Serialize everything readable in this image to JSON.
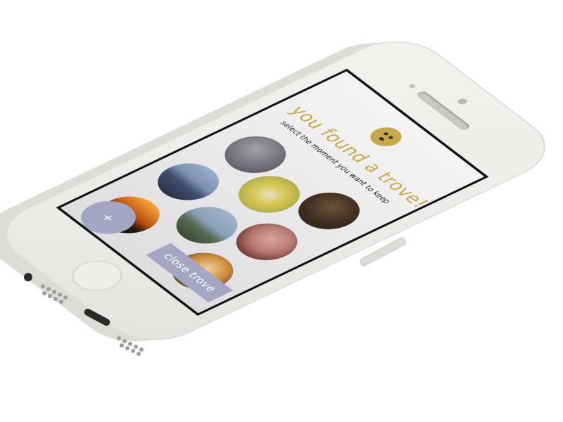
{
  "app": {
    "title": "you found a trove!",
    "subtitle": "select the moment you want to keep"
  },
  "moments": [
    {
      "name": "moment-photo-1"
    },
    {
      "name": "moment-photo-2"
    },
    {
      "name": "moment-photo-3"
    },
    {
      "name": "moment-photo-4"
    },
    {
      "name": "moment-photo-5"
    },
    {
      "name": "moment-photo-6"
    },
    {
      "name": "moment-photo-7"
    },
    {
      "name": "moment-photo-8"
    }
  ],
  "actions": {
    "close_label": "close trove",
    "add_label": "+"
  },
  "icons": {
    "trove": "trove-face-icon"
  },
  "colors": {
    "accent": "#c8a84a",
    "button": "#a4a6c4",
    "phone_body": "#ecebe7",
    "screen_bezel": "#111111"
  }
}
